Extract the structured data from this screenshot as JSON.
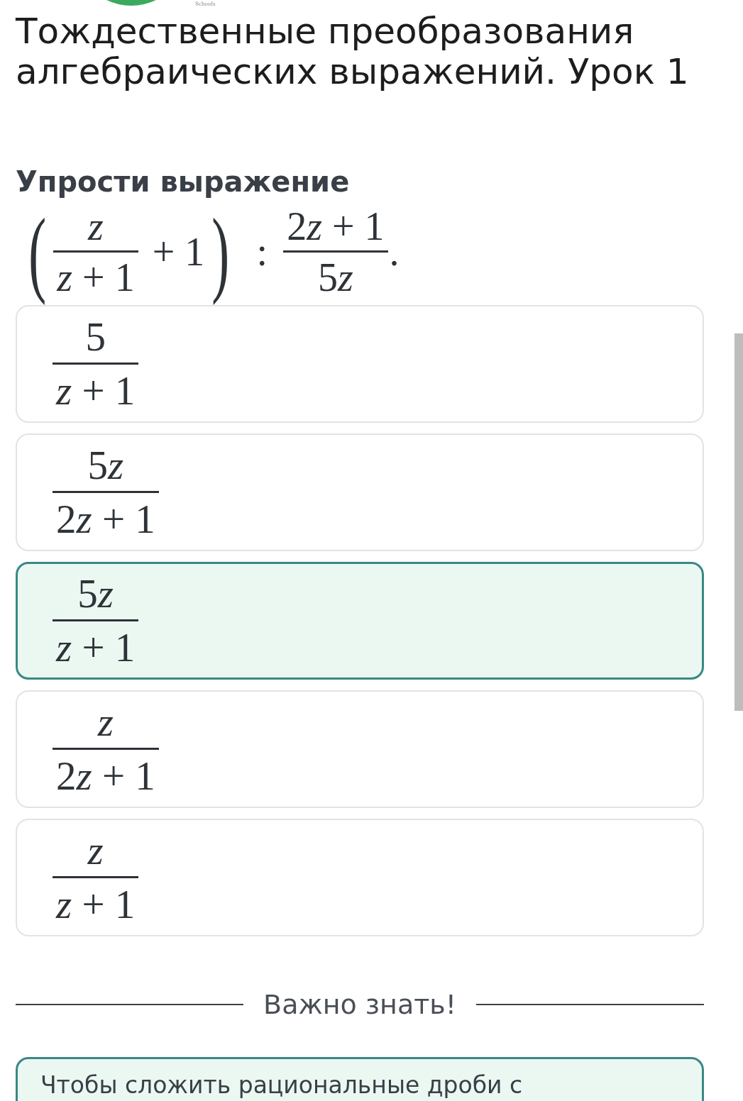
{
  "header": {
    "logo_text": "Schools",
    "title": "Тождественные преобразования алгебраических выражений. Урок 1"
  },
  "question": {
    "title": "Упрости выражение",
    "expression": {
      "open_paren": "(",
      "fraction": {
        "numerator": "z",
        "denominator": "z + 1"
      },
      "addend": "+ 1",
      "close_paren": ")",
      "operator": ":",
      "divisor": {
        "numerator": "2z + 1",
        "denominator": "5z"
      },
      "end_mark": "."
    }
  },
  "options": [
    {
      "numerator": "5",
      "denominator": "z + 1",
      "selected": false
    },
    {
      "numerator": "5z",
      "denominator": "2z + 1",
      "selected": false
    },
    {
      "numerator": "5z",
      "denominator": "z + 1",
      "selected": true
    },
    {
      "numerator": "z",
      "denominator": "2z + 1",
      "selected": false
    },
    {
      "numerator": "z",
      "denominator": "z + 1",
      "selected": false
    }
  ],
  "section_heading": "Важно знать!",
  "info_box": {
    "text": "Чтобы сложить рациональные дроби с"
  }
}
